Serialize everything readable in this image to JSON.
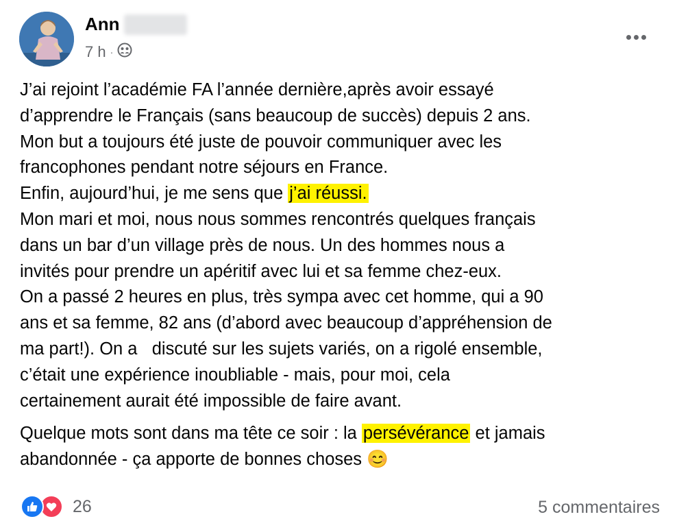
{
  "post": {
    "author": "Ann",
    "time": "7 h",
    "separator": "·",
    "audience_icon": "friends-icon",
    "paragraphs": [
      [
        {
          "text": "J’ai rejoint l’académie FA l’année dernière,après avoir essayé"
        },
        {
          "text": "d’apprendre le Français (sans beaucoup de succès) depuis 2 ans."
        },
        {
          "text": "Mon but a toujours été juste de pouvoir communiquer avec les"
        },
        {
          "text": "francophones pendant notre séjours en France."
        },
        {
          "text": "Enfin, aujourd’hui, je me sens que ",
          "highlight": "j’ai réussi."
        },
        {
          "text": "Mon mari et moi, nous nous sommes rencontrés quelques français"
        },
        {
          "text": "dans un bar d’un village près de nous. Un des hommes nous a"
        },
        {
          "text": "invités pour prendre un apéritif avec lui et sa femme chez-eux."
        },
        {
          "text": "On a passé 2 heures en plus, très sympa avec cet homme, qui a 90"
        },
        {
          "text": "ans et sa femme, 82 ans (d’abord avec beaucoup d’appréhension de"
        },
        {
          "text": "ma part!). On a   discuté sur les sujets variés, on a rigolé ensemble,"
        },
        {
          "text": "c’était une expérience inoubliable - mais, pour moi, cela"
        },
        {
          "text": "certainement aurait été impossible de faire avant."
        }
      ],
      [
        {
          "text": "Quelque mots sont dans ma tête ce soir : la ",
          "highlight": "persévérance",
          "after": " et jamais"
        },
        {
          "text": "abandonnée - ça apporte de bonnes choses ",
          "emoji": "😊"
        }
      ]
    ]
  },
  "reactions": {
    "icons": [
      "like-icon",
      "love-icon"
    ],
    "count": "26"
  },
  "comments_label": "5 commentaires",
  "colors": {
    "highlight": "#fff200",
    "like": "#1877f2",
    "love": "#f33e58",
    "secondary_text": "#65676b"
  }
}
